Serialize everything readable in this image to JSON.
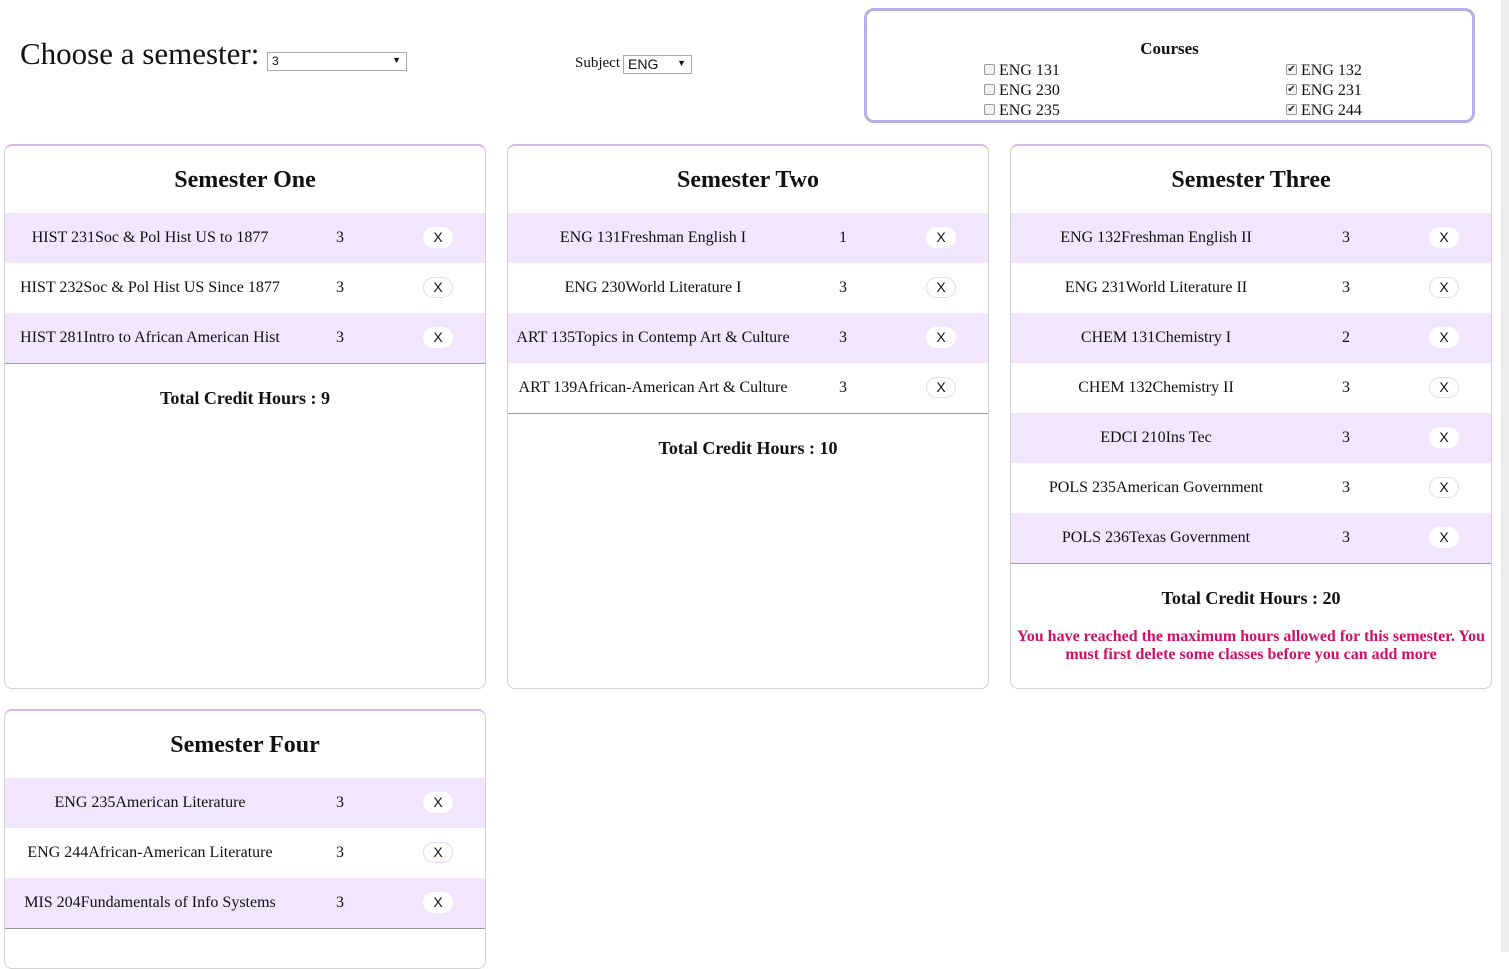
{
  "header": {
    "title": "Choose a semester:",
    "semester_select": "3",
    "subject_label": "Subject",
    "subject_select": "ENG"
  },
  "courses_panel": {
    "title": "Courses",
    "left": [
      {
        "label": "ENG 131",
        "checked": false
      },
      {
        "label": "ENG 230",
        "checked": false
      },
      {
        "label": "ENG 235",
        "checked": false
      }
    ],
    "right": [
      {
        "label": "ENG 132",
        "checked": true
      },
      {
        "label": "ENG 231",
        "checked": true
      },
      {
        "label": "ENG 244",
        "checked": true
      }
    ]
  },
  "semesters": [
    {
      "title": "Semester One",
      "rows": [
        {
          "course": "HIST 231Soc & Pol Hist US to 1877",
          "credits": "3",
          "x": "X"
        },
        {
          "course": "HIST 232Soc & Pol Hist US Since 1877",
          "credits": "3",
          "x": "X"
        },
        {
          "course": "HIST 281Intro to African American Hist",
          "credits": "3",
          "x": "X"
        }
      ],
      "total": "Total Credit Hours : 9"
    },
    {
      "title": "Semester Two",
      "rows": [
        {
          "course": "ENG 131Freshman English I",
          "credits": "1",
          "x": "X"
        },
        {
          "course": "ENG 230World Literature I",
          "credits": "3",
          "x": "X"
        },
        {
          "course": "ART 135Topics in Contemp Art & Culture",
          "credits": "3",
          "x": "X"
        },
        {
          "course": "ART 139African-American Art & Culture",
          "credits": "3",
          "x": "X"
        }
      ],
      "total": "Total Credit Hours : 10"
    },
    {
      "title": "Semester Three",
      "rows": [
        {
          "course": "ENG 132Freshman English II",
          "credits": "3",
          "x": "X"
        },
        {
          "course": "ENG 231World Literature II",
          "credits": "3",
          "x": "X"
        },
        {
          "course": "CHEM 131Chemistry I",
          "credits": "2",
          "x": "X"
        },
        {
          "course": "CHEM 132Chemistry II",
          "credits": "3",
          "x": "X"
        },
        {
          "course": "EDCI 210Ins Tec",
          "credits": "3",
          "x": "X"
        },
        {
          "course": "POLS 235American Government",
          "credits": "3",
          "x": "X"
        },
        {
          "course": "POLS 236Texas Government",
          "credits": "3",
          "x": "X"
        }
      ],
      "total": "Total Credit Hours : 20",
      "warning": "You have reached the maximum hours allowed for this semester. You must first delete some classes before you can add more"
    },
    {
      "title": "Semester Four",
      "rows": [
        {
          "course": "ENG 235American Literature",
          "credits": "3",
          "x": "X"
        },
        {
          "course": "ENG 244African-American Literature",
          "credits": "3",
          "x": "X"
        },
        {
          "course": "MIS 204Fundamentals of Info Systems",
          "credits": "3",
          "x": "X"
        }
      ],
      "total": ""
    }
  ],
  "colors": {
    "row_highlight": "#f1e6fd",
    "panel_border": "#b8aee6",
    "card_top_border": "#d8b8ec",
    "warning": "#cc1166"
  }
}
